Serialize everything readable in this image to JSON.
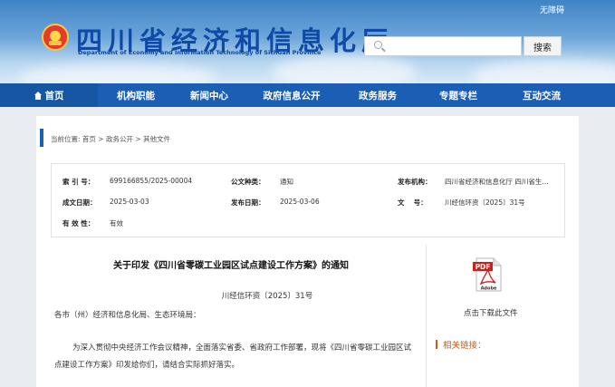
{
  "header": {
    "accessible_label": "无障碍",
    "title": "四川省经济和信息化厅",
    "subtitle": "Department of Economy and Information Technology of Sichuan Province",
    "search_placeholder": "",
    "search_button": "搜索"
  },
  "nav": {
    "items": [
      {
        "label": "首页"
      },
      {
        "label": "机构职能"
      },
      {
        "label": "新闻中心"
      },
      {
        "label": "政府信息公开"
      },
      {
        "label": "政务服务"
      },
      {
        "label": "专题专栏"
      },
      {
        "label": "互动交流"
      }
    ]
  },
  "breadcrumb": "当前位置: 首页 > 政务公开 > 其他文件",
  "meta": {
    "index_label": "索 引 号：",
    "index_value": "699166855/2025-00004",
    "category_label": "公文种类：",
    "category_value": "通知",
    "publisher_label": "发布机构：",
    "publisher_value": "四川省经济和信息化厅 四川省生...",
    "created_label": "成文日期：",
    "created_value": "2025-03-03",
    "published_label": "发布日期：",
    "published_value": "2025-03-06",
    "docno_label": "文　 号：",
    "docno_value": "川经信环资〔2025〕31号",
    "validity_label": "有 效 性：",
    "validity_value": "有效"
  },
  "article": {
    "title": "关于印发《四川省零碳工业园区试点建设工作方案》的通知",
    "doc_number": "川经信环资〔2025〕31号",
    "addressee": "各市（州）经济和信息化局、生态环境局：",
    "body": "为深入贯彻中央经济工作会议精神，全面落实省委、省政府工作部署，现将《四川省零碳工业园区试点建设工作方案》印发给你们，请结合实际抓好落实。"
  },
  "sidebar": {
    "pdf_badge": "PDF",
    "pdf_brand": "Adobe",
    "download_label": "点击下载此文件",
    "related_label": "相关链接："
  },
  "colors": {
    "nav_bg": "#1a5fb4",
    "title_blue": "#0e4aa6",
    "related_orange": "#cc5a1c"
  }
}
